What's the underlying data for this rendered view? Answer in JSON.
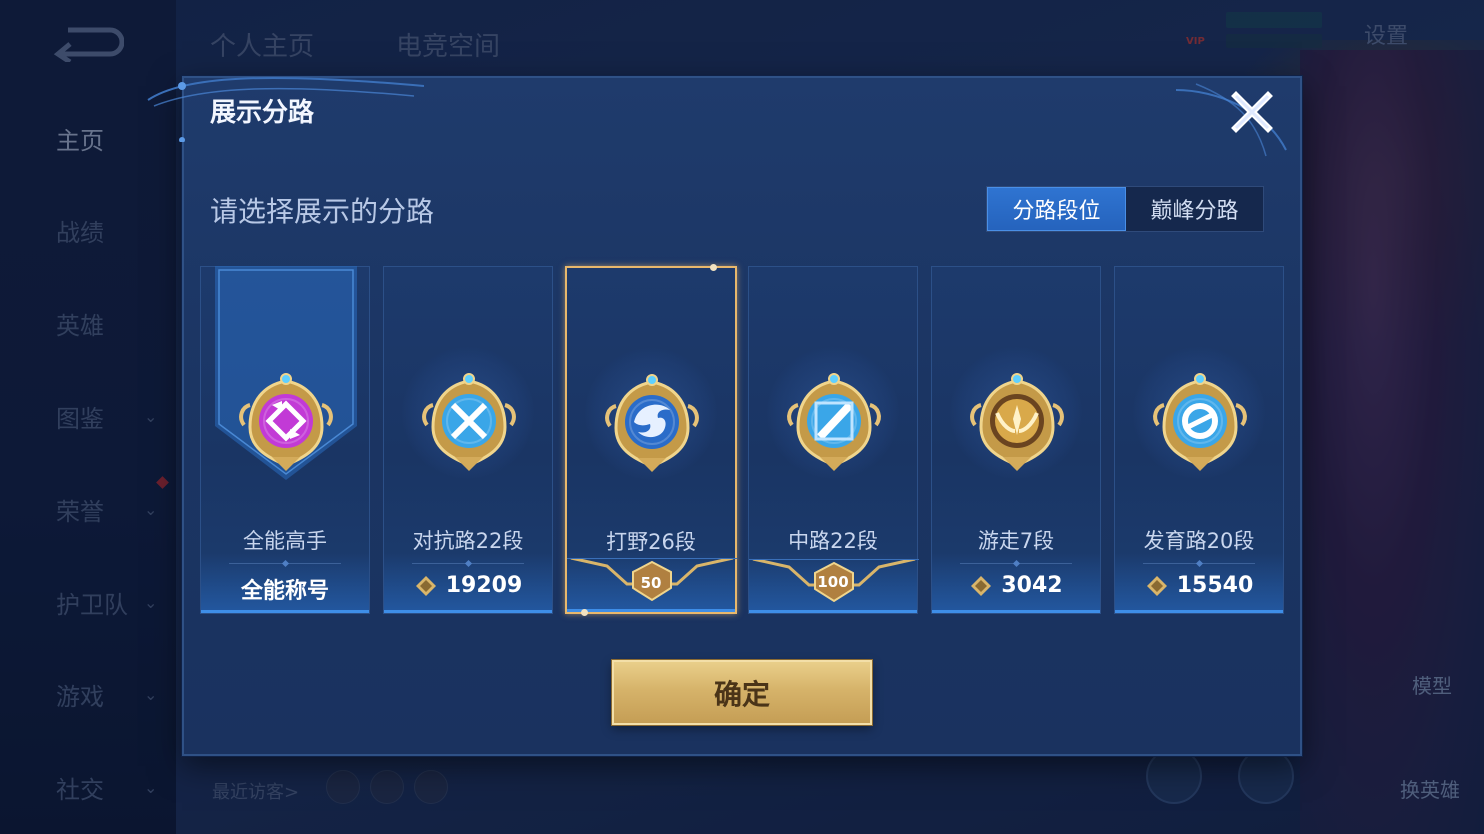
{
  "background": {
    "sidebar": {
      "items": [
        {
          "label": "主页",
          "chevron": false,
          "active": true
        },
        {
          "label": "战绩",
          "chevron": false
        },
        {
          "label": "英雄",
          "chevron": false
        },
        {
          "label": "图鉴",
          "chevron": true
        },
        {
          "label": "荣誉",
          "chevron": true
        },
        {
          "label": "护卫队",
          "chevron": true
        },
        {
          "label": "游戏",
          "chevron": true
        },
        {
          "label": "社交",
          "chevron": true
        }
      ]
    },
    "tabs": [
      "个人主页",
      "电竞空间"
    ],
    "settings_label": "设置",
    "vip_label": "VIP",
    "model_label": "模型",
    "switch_hero_label": "换英雄",
    "recent_visitors_label": "最近访客>"
  },
  "modal": {
    "title": "展示分路",
    "prompt": "请选择展示的分路",
    "segments": [
      {
        "label": "分路段位",
        "active": true
      },
      {
        "label": "巅峰分路",
        "active": false
      }
    ],
    "cards": [
      {
        "name": "全能高手",
        "value": "全能称号",
        "icon": "all-round-emblem-icon",
        "kind": "title",
        "color": "#c23ad6"
      },
      {
        "name": "对抗路22段",
        "value": "19209",
        "icon": "clash-lane-emblem-icon",
        "kind": "points",
        "color": "#3aa6e8"
      },
      {
        "name": "打野26段",
        "value": "50",
        "icon": "jungle-emblem-icon",
        "kind": "star",
        "selected": true,
        "color": "#2a6cc9"
      },
      {
        "name": "中路22段",
        "value": "100",
        "icon": "mid-lane-emblem-icon",
        "kind": "star",
        "color": "#3aa6e8"
      },
      {
        "name": "游走7段",
        "value": "3042",
        "icon": "roam-emblem-icon",
        "kind": "points",
        "color": "#d9a94a"
      },
      {
        "name": "发育路20段",
        "value": "15540",
        "icon": "farm-lane-emblem-icon",
        "kind": "points",
        "color": "#3aa6e8"
      }
    ],
    "confirm_label": "确定"
  }
}
